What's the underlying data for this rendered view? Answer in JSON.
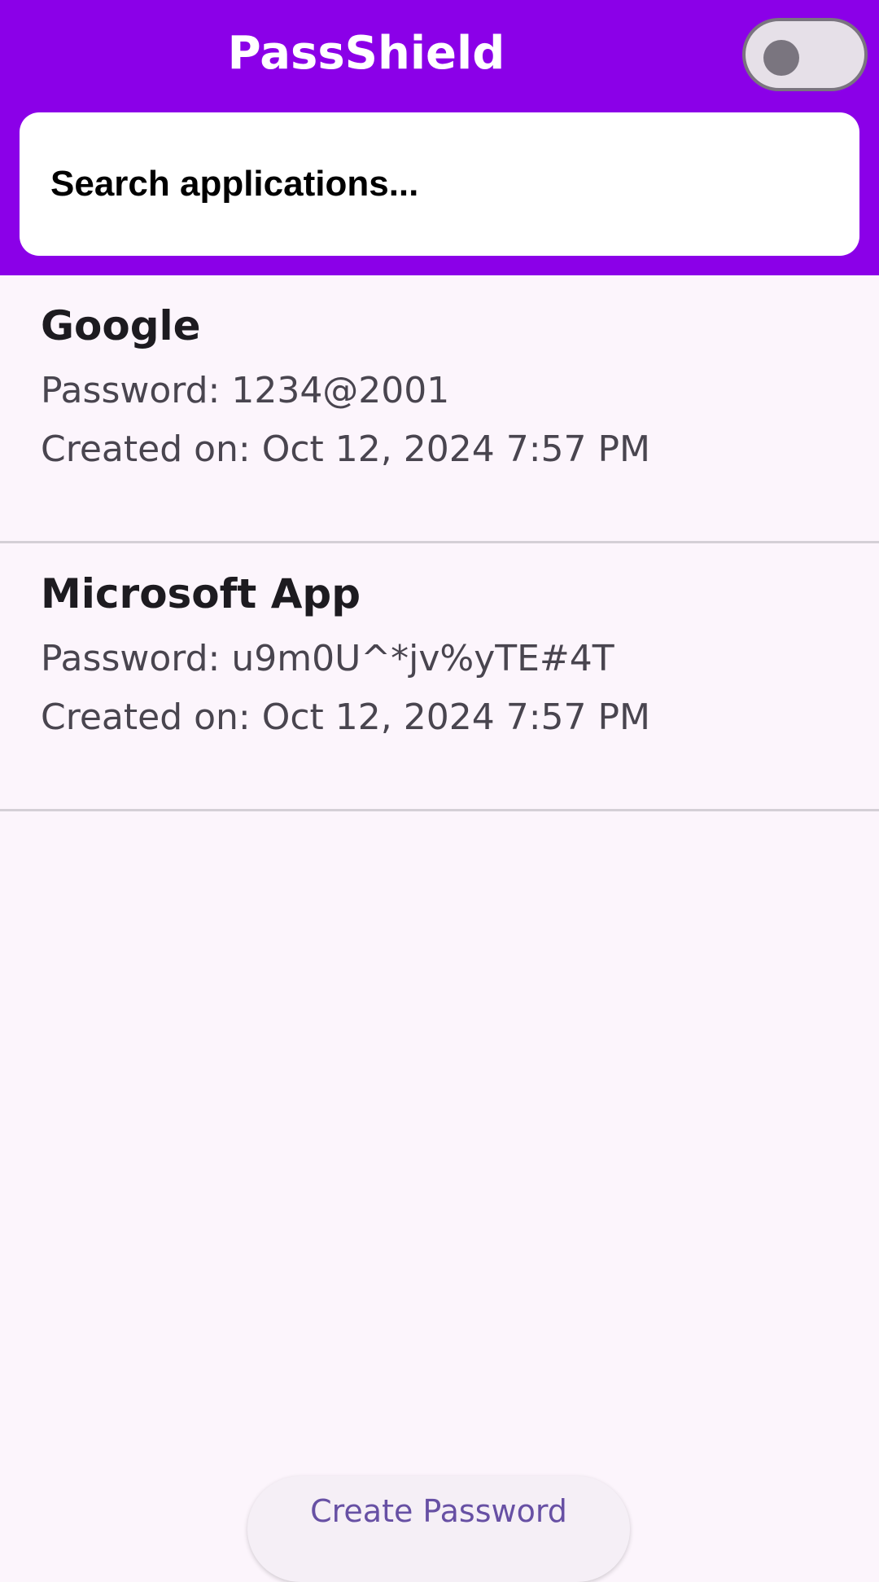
{
  "app": {
    "title": "PassShield"
  },
  "theme_toggle": {
    "state": "off"
  },
  "search": {
    "placeholder": "Search applications..."
  },
  "entries": [
    {
      "name": "Google",
      "password_line": "Password: 1234@2001",
      "created_line": "Created on: Oct 12, 2024 7:57 PM"
    },
    {
      "name": "Microsoft App",
      "password_line": "Password: u9m0U^*jv%yTE#4T",
      "created_line": "Created on: Oct 12, 2024 7:57 PM"
    }
  ],
  "actions": {
    "create_label": "Create Password"
  },
  "colors": {
    "primary": "#8B00E8",
    "background": "#FCF5FC",
    "accent_text": "#6750A4"
  }
}
